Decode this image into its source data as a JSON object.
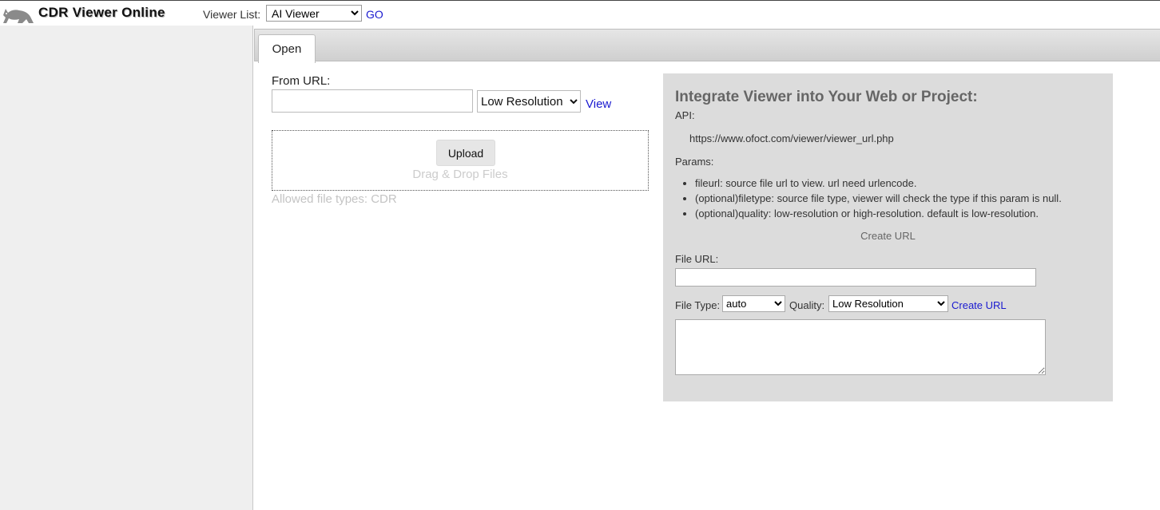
{
  "header": {
    "site_title": "CDR Viewer Online",
    "viewer_list_label": "Viewer List:",
    "viewer_selected": "AI Viewer",
    "go_label": "GO"
  },
  "tabs": [
    {
      "label": "Open"
    }
  ],
  "open_panel": {
    "from_url_label": "From URL:",
    "url_value": "",
    "resolution_selected": "Low Resolution",
    "view_label": "View",
    "upload_label": "Upload",
    "drag_drop_text": "Drag & Drop Files",
    "allowed_types": "Allowed file types: CDR"
  },
  "integrate": {
    "title": "Integrate Viewer into Your Web or Project:",
    "api_label": "API:",
    "api_url": "https://www.ofoct.com/viewer/viewer_url.php",
    "params_label": "Params:",
    "params": [
      "fileurl: source file url to view. url need urlencode.",
      "(optional)filetype: source file type, viewer will check the type if this param is null.",
      "(optional)quality: low-resolution or high-resolution. default is low-resolution."
    ],
    "create_url_heading": "Create URL",
    "file_url_label": "File URL:",
    "file_url_value": "",
    "file_type_label": "File Type:",
    "file_type_selected": "auto",
    "quality_label": "Quality:",
    "quality_selected": "Low Resolution",
    "create_url_link": "Create URL",
    "result_value": ""
  },
  "icons": {
    "logo": "cat-logo-icon"
  }
}
